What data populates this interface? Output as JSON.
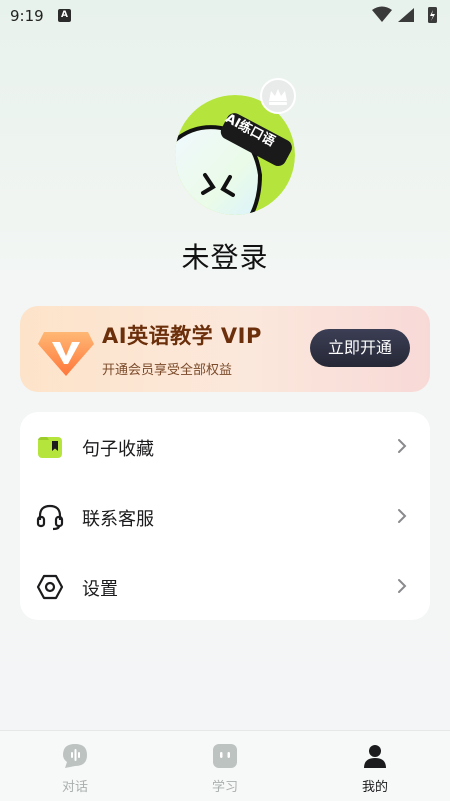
{
  "status_bar": {
    "time": "9:19",
    "notification_badge": "A"
  },
  "profile": {
    "avatar_label": "AI练口语",
    "username": "未登录"
  },
  "vip": {
    "title": "AI英语教学  VIP",
    "subtitle": "开通会员享受全部权益",
    "button_label": "立即开通"
  },
  "menu": {
    "items": [
      {
        "label": "句子收藏",
        "icon": "bookmark-folder-icon"
      },
      {
        "label": "联系客服",
        "icon": "headset-icon"
      },
      {
        "label": "设置",
        "icon": "settings-hexagon-icon"
      }
    ]
  },
  "tabs": [
    {
      "label": "对话",
      "icon": "chat-voice-icon",
      "active": false
    },
    {
      "label": "学习",
      "icon": "study-icon",
      "active": false
    },
    {
      "label": "我的",
      "icon": "person-icon",
      "active": true
    }
  ],
  "colors": {
    "brand_green": "#b5e53d",
    "vip_text": "#6b2f0b",
    "dark_button": "#2c2e3e"
  }
}
